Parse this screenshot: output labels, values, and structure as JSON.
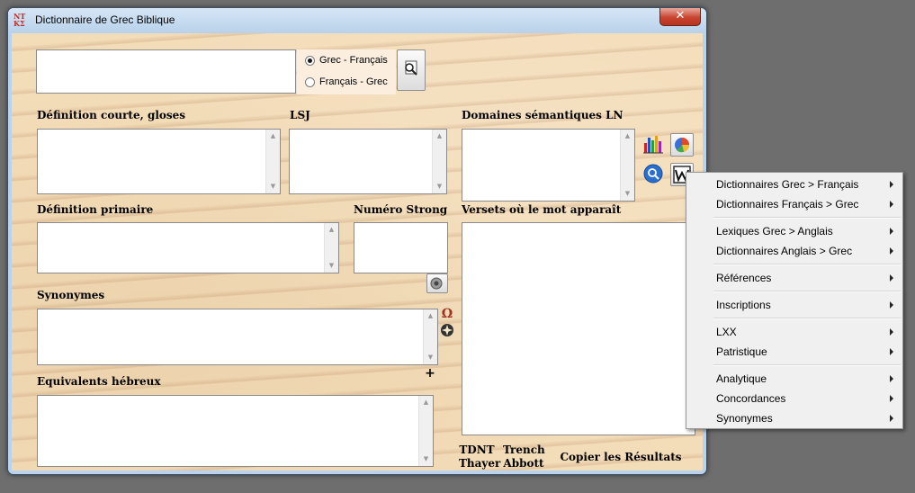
{
  "window": {
    "title": "Dictionnaire de Grec Biblique",
    "close_glyph": "✕",
    "icon_text": "ΝΤ\nΚΣ"
  },
  "search": {
    "input_value": "",
    "radio_grec_francais": "Grec - Français",
    "radio_francais_grec": "Français - Grec",
    "selected": "grec-francais"
  },
  "labels": {
    "definition_courte": "Définition courte, gloses",
    "lsj": "LSJ",
    "domaines": "Domaines sémantiques LN",
    "definition_primaire": "Définition primaire",
    "numero_strong": "Numéro Strong",
    "versets": "Versets où le mot apparaît",
    "synonymes": "Synonymes",
    "equivalents_hebreux": "Equivalents hébreux"
  },
  "buttons": {
    "plus": "+",
    "omega": "Ω",
    "tdnt": "TDNT",
    "thayer": "Thayer",
    "trench": "Trench",
    "abbott": "Abbott",
    "copier": "Copier les Résultats"
  },
  "context_menu": {
    "groups": [
      [
        "Dictionnaires Grec > Français",
        "Dictionnaires Français > Grec"
      ],
      [
        "Lexiques Grec > Anglais",
        "Dictionnaires Anglais > Grec"
      ],
      [
        "Références"
      ],
      [
        "Inscriptions"
      ],
      [
        "LXX",
        "Patristique"
      ],
      [
        "Analytique",
        "Concordances",
        "Synonymes"
      ]
    ]
  },
  "colors": {
    "accent_close": "#c9452f",
    "parchment": "#f3dcb8",
    "menu_bg": "#f0f0f0"
  }
}
